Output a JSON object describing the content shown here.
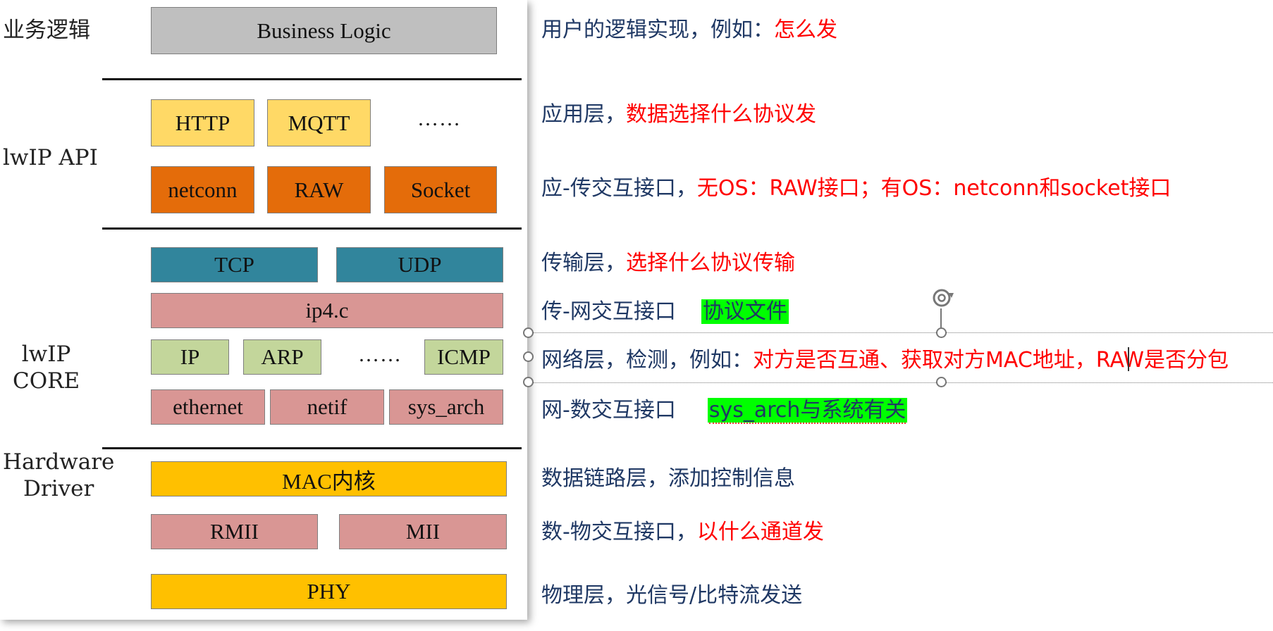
{
  "side_labels": {
    "business": "业务逻辑",
    "api": "lwIP API",
    "core": "lwIP\nCORE",
    "hw": "Hardware\nDriver"
  },
  "blocks": {
    "business_logic": "Business Logic",
    "http": "HTTP",
    "mqtt": "MQTT",
    "api_more": "……",
    "netconn": "netconn",
    "raw": "RAW",
    "socket": "Socket",
    "tcp": "TCP",
    "udp": "UDP",
    "ip4c": "ip4.c",
    "ip": "IP",
    "arp": "ARP",
    "core_more": "……",
    "icmp": "ICMP",
    "ethernet": "ethernet",
    "netif": "netif",
    "sys_arch": "sys_arch",
    "mac_core": "MAC内核",
    "rmii": "RMII",
    "mii": "MII",
    "phy": "PHY"
  },
  "colors": {
    "gray": "#bfbfbf",
    "yellow_light": "#ffd966",
    "orange": "#e46c0a",
    "teal": "#31859c",
    "pink": "#d99694",
    "green": "#c3d69b",
    "gold": "#ffc000",
    "note_blue": "#1f3864",
    "note_red": "#ff0000",
    "highlight": "#00ff00"
  },
  "notes": {
    "n1_blue": "用户的逻辑实现，例如：",
    "n1_red": "怎么发",
    "n2_blue": "应用层，",
    "n2_red": "数据选择什么协议发",
    "n3_blue": "应-传交互接口，",
    "n3_red": "无OS：RAW接口；有OS：netconn和socket接口",
    "n4_blue": "传输层，",
    "n4_red": "选择什么协议传输",
    "n5_blue": "传-网交互接口",
    "n5_hl": "协议文件",
    "n6_blue": "网络层，检测，例如：",
    "n6_red": "对方是否互通、获取对方MAC地址，RAW是否分包",
    "n7_blue": "网-数交互接口",
    "n7_hl": "sys_arch与系统有关",
    "n8_blue": "数据链路层，添加控制信息",
    "n9_blue": "数-物交互接口，",
    "n9_red": "以什么通道发",
    "n10_blue": "物理层，光信号/比特流发送"
  }
}
